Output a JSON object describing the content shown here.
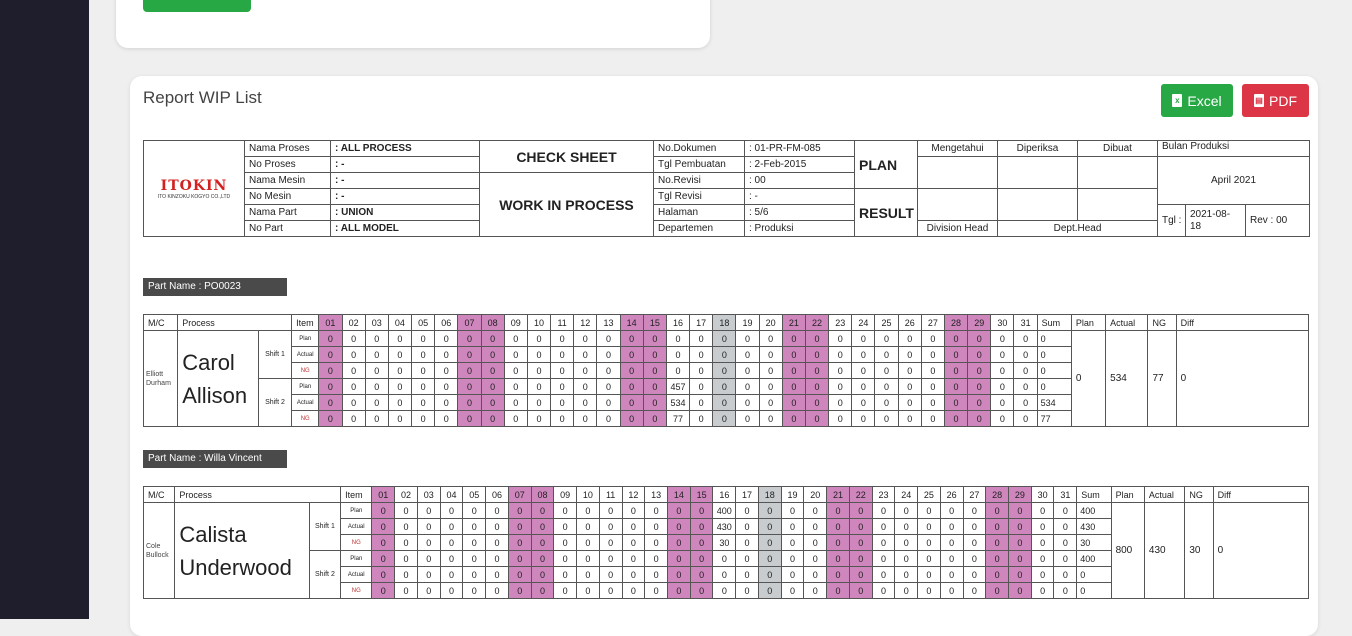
{
  "top_card": {},
  "report": {
    "title": "Report WIP List",
    "excel_label": "Excel",
    "pdf_label": "PDF"
  },
  "header": {
    "logo_text": "ITOKIN",
    "logo_sub": "ITO KINZOKU KOGYO CO.,LTD",
    "fields": [
      {
        "label": "Nama Proses",
        "value": ": ALL PROCESS"
      },
      {
        "label": "No Proses",
        "value": ": -"
      },
      {
        "label": "Nama Mesin",
        "value": ": -"
      },
      {
        "label": "No Mesin",
        "value": ": -"
      },
      {
        "label": "Nama Part",
        "value": ": UNION"
      },
      {
        "label": "No Part",
        "value": ": ALL MODEL"
      }
    ],
    "check_sheet": "CHECK SHEET",
    "wip": "WORK IN PROCESS",
    "doc_fields": [
      {
        "label": "No.Dokumen",
        "value": ": 01-PR-FM-085"
      },
      {
        "label": "Tgl Pembuatan",
        "value": ": 2-Feb-2015"
      },
      {
        "label": "No.Revisi",
        "value": ": 00"
      },
      {
        "label": "Tgl Revisi",
        "value": ": -"
      },
      {
        "label": "Halaman",
        "value": ": 5/6"
      },
      {
        "label": "Departemen",
        "value": ": Produksi"
      }
    ],
    "plan": "PLAN",
    "result": "RESULT",
    "mengetahui": "Mengetahui",
    "diperiksa": "Diperiksa",
    "dibuat": "Dibuat",
    "division_head": "Division Head",
    "dept_head": "Dept.Head",
    "bulan_label": "Bulan Produksi",
    "bulan_value": "April 2021",
    "tgl_label": "Tgl :",
    "tgl_value": "2021-08-18",
    "rev": "Rev : 00"
  },
  "columns": {
    "mc": "M/C",
    "process": "Process",
    "item": "Item",
    "days": [
      "01",
      "02",
      "03",
      "04",
      "05",
      "06",
      "07",
      "08",
      "09",
      "10",
      "11",
      "12",
      "13",
      "14",
      "15",
      "16",
      "17",
      "18",
      "19",
      "20",
      "21",
      "22",
      "23",
      "24",
      "25",
      "26",
      "27",
      "28",
      "29",
      "30",
      "31"
    ],
    "sum": "Sum",
    "plan": "Plan",
    "actual": "Actual",
    "ng": "NG",
    "diff": "Diff"
  },
  "colors": {
    "weekend": "#cf86bd",
    "holiday": "#c8ccce"
  },
  "pink_days": [
    0,
    6,
    7,
    13,
    14,
    20,
    21,
    27,
    28
  ],
  "gray_days": [
    17
  ],
  "parts": [
    {
      "label": "Part Name : PO0023",
      "mc": "Elliott Durham",
      "operator": "Carol Allison",
      "rows": [
        {
          "shift": "Shift 1",
          "item": "Plan",
          "d16": "0",
          "sum": "0"
        },
        {
          "item": "Actual",
          "d16": "0",
          "sum": "0"
        },
        {
          "item": "NG",
          "d16": "0",
          "sum": "0"
        },
        {
          "shift": "Shift 2",
          "item": "Plan",
          "d16": "457",
          "sum": "0"
        },
        {
          "item": "Actual",
          "d16": "534",
          "sum": "534"
        },
        {
          "item": "NG",
          "d16": "77",
          "sum": "77"
        }
      ],
      "totals": {
        "plan": "0",
        "actual": "534",
        "ng": "77",
        "diff": "0"
      }
    },
    {
      "label": "Part Name : Willa Vincent",
      "mc": "Cole Bullock",
      "operator": "Calista Underwood",
      "rows": [
        {
          "shift": "Shift 1",
          "item": "Plan",
          "d16": "400",
          "sum": "400"
        },
        {
          "item": "Actual",
          "d16": "430",
          "sum": "430"
        },
        {
          "item": "NG",
          "d16": "30",
          "sum": "30"
        },
        {
          "shift": "Shift 2",
          "item": "Plan",
          "d16": "0",
          "sum": "400"
        },
        {
          "item": "Actual",
          "d16": "0",
          "sum": "0"
        },
        {
          "item": "NG",
          "d16": "0",
          "sum": "0"
        }
      ],
      "totals": {
        "plan": "800",
        "actual": "430",
        "ng": "30",
        "diff": "0"
      }
    }
  ]
}
